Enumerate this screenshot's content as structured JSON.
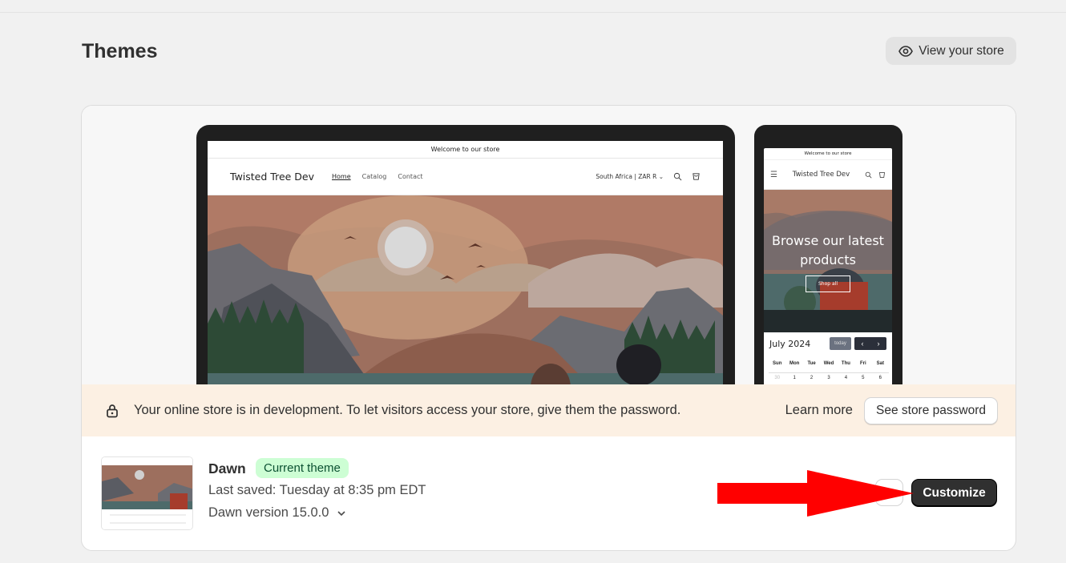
{
  "header": {
    "title": "Themes",
    "view_store_label": "View your store"
  },
  "preview": {
    "desktop": {
      "announcement": "Welcome to our store",
      "store_name": "Twisted Tree Dev",
      "nav": [
        "Home",
        "Catalog",
        "Contact"
      ],
      "currency": "South Africa | ZAR R"
    },
    "mobile": {
      "announcement": "Welcome to our store",
      "store_name": "Twisted Tree Dev",
      "hero_heading": "Browse our latest products",
      "hero_button": "Shop all",
      "calendar": {
        "month": "July 2024",
        "today_label": "today",
        "days": [
          "Sun",
          "Mon",
          "Tue",
          "Wed",
          "Thu",
          "Fri",
          "Sat"
        ],
        "dates": [
          "30",
          "1",
          "2",
          "3",
          "4",
          "5",
          "6"
        ]
      }
    }
  },
  "banner": {
    "message": "Your online store is in development. To let visitors access your store, give them the password.",
    "learn_more": "Learn more",
    "see_password": "See store password"
  },
  "theme": {
    "name": "Dawn",
    "badge": "Current theme",
    "last_saved": "Last saved: Tuesday at 8:35 pm EDT",
    "version": "Dawn version 15.0.0",
    "customize_label": "Customize"
  },
  "colors": {
    "badge_bg": "#cdfed4",
    "badge_text": "#0c5132",
    "banner_bg": "#fcf0e3",
    "primary_button": "#303030",
    "annotation_arrow": "#ff0000"
  }
}
